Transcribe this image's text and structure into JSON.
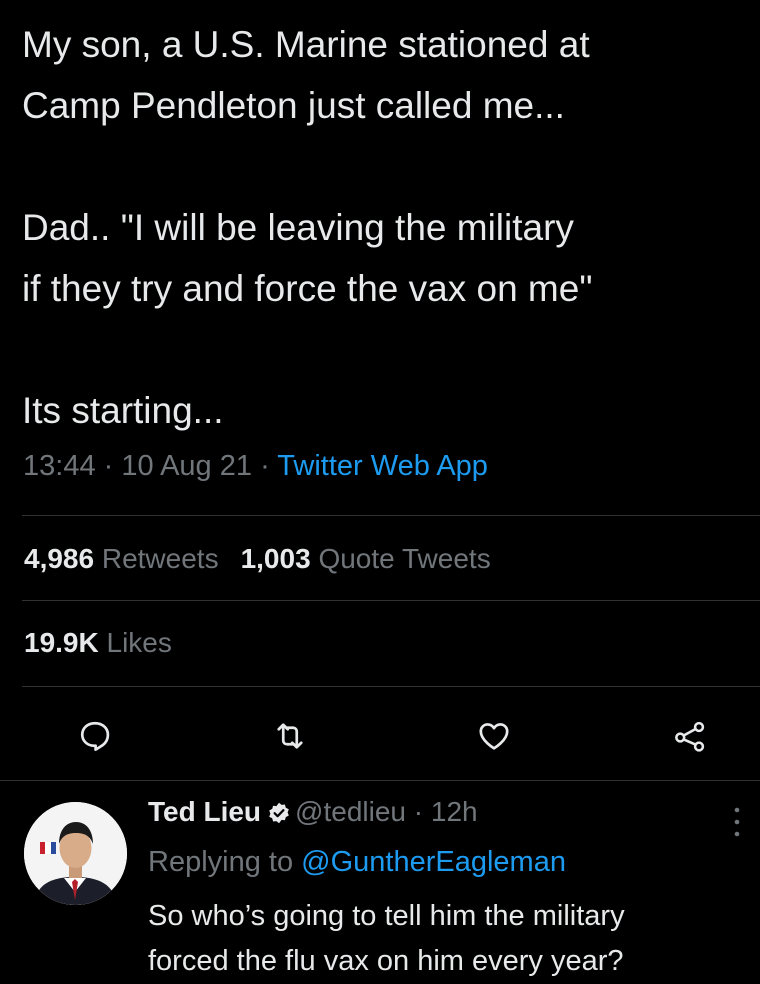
{
  "tweet": {
    "line1": "My son, a U.S. Marine stationed at",
    "line2": "Camp Pendleton just called me...",
    "line3": "Dad..  \"I will be leaving the military",
    "line4": "if they try and force the vax on me\"",
    "line5": "Its starting...",
    "time": "13:44",
    "separator": "·",
    "date": "10 Aug 21",
    "source": "Twitter Web App"
  },
  "stats": {
    "retweets_count": "4,986",
    "retweets_label": "Retweets",
    "quotes_count": "1,003",
    "quotes_label": "Quote Tweets",
    "likes_count": "19.9K",
    "likes_label": "Likes"
  },
  "actions": {
    "icons": [
      "reply-icon",
      "retweet-icon",
      "like-icon",
      "share-icon"
    ]
  },
  "reply": {
    "name": "Ted Lieu",
    "handle": "@tedlieu",
    "separator": "·",
    "age": "12h",
    "replying_prefix": "Replying to",
    "replying_to": "@GuntherEagleman",
    "text_line1": "So who’s going to tell him the military",
    "text_line2": "forced the flu vax on him every year?"
  },
  "colors": {
    "background": "#000000",
    "text": "#e7e9ea",
    "muted": "#71767b",
    "accent": "#1d9bf0",
    "divider": "#2f3336"
  }
}
